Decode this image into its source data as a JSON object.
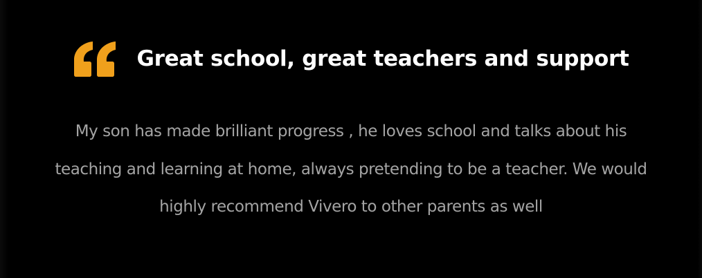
{
  "testimonial": {
    "quote_icon": "quote-mark-icon",
    "accent_color": "#f0a01c",
    "title": "Great school, great teachers and support",
    "body": "My son has made brilliant progress , he loves school and talks about his teaching and learning at home, always pretending to be a teacher. We would highly recommend Vivero to other parents as well"
  }
}
